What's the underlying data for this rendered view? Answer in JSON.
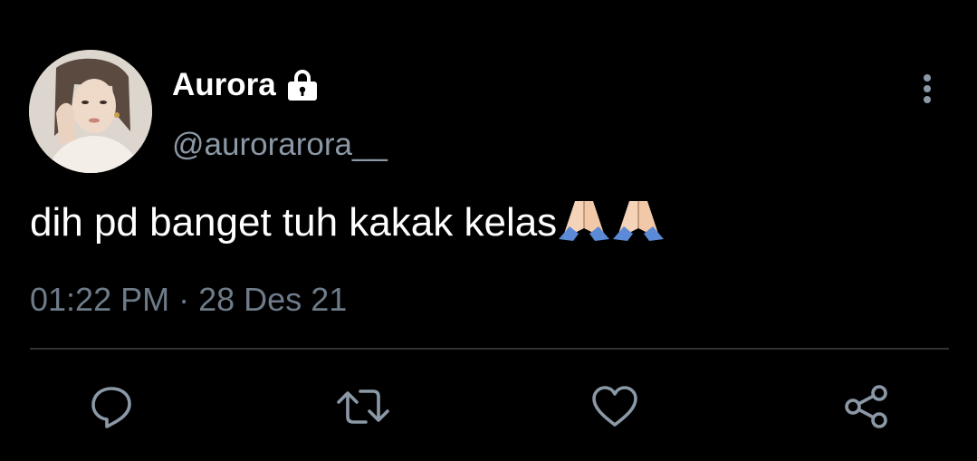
{
  "tweet": {
    "display_name": "Aurora",
    "handle": "@aurorarora__",
    "text": "dih pd banget tuh kakak kelas",
    "emoji": "🙏🏻🙏🏻",
    "time": "01:22 PM",
    "separator": "·",
    "date": "28 Des 21"
  },
  "icons": {
    "lock": "lock-icon",
    "more": "more-vertical-icon",
    "reply": "reply-icon",
    "retweet": "retweet-icon",
    "like": "heart-icon",
    "share": "share-icon"
  },
  "colors": {
    "background": "#000000",
    "primary_text": "#ffffff",
    "secondary_text": "#8b98a5",
    "icon": "#8b98a5",
    "divider": "#2f3336"
  }
}
